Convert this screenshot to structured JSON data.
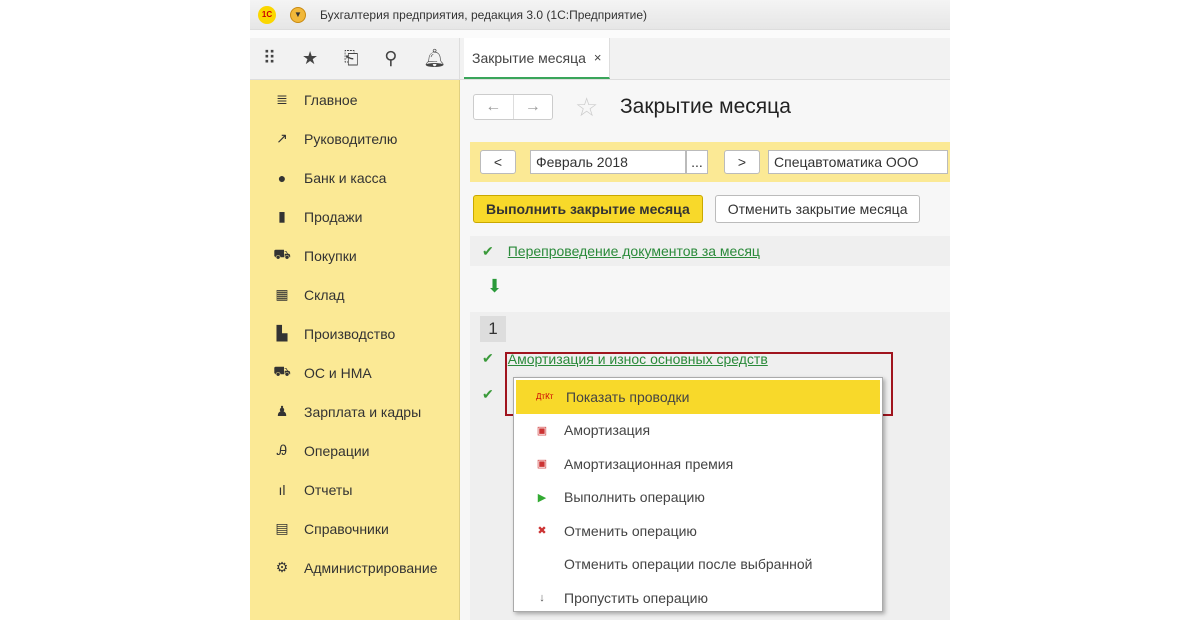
{
  "window": {
    "title": "Бухгалтерия предприятия, редакция 3.0  (1С:Предприятие)",
    "logo": "1С"
  },
  "toolbar": {
    "icons": [
      "apps-grid-icon",
      "star-icon",
      "history-icon",
      "search-icon",
      "bell-icon"
    ]
  },
  "tab": {
    "label": "Закрытие месяца",
    "close": "×"
  },
  "sidebar": {
    "items": [
      {
        "label": "Главное",
        "icon": "≣"
      },
      {
        "label": "Руководителю",
        "icon": "↗"
      },
      {
        "label": "Банк и касса",
        "icon": "●"
      },
      {
        "label": "Продажи",
        "icon": "▮"
      },
      {
        "label": "Покупки",
        "icon": "⛟"
      },
      {
        "label": "Склад",
        "icon": "▦"
      },
      {
        "label": "Производство",
        "icon": "▙"
      },
      {
        "label": "ОС и НМА",
        "icon": "⛟"
      },
      {
        "label": "Зарплата и кадры",
        "icon": "♟"
      },
      {
        "label": "Операции",
        "icon": "Ꭿ"
      },
      {
        "label": "Отчеты",
        "icon": "ıl"
      },
      {
        "label": "Справочники",
        "icon": "▤"
      },
      {
        "label": "Администрирование",
        "icon": "⚙"
      }
    ]
  },
  "page": {
    "title": "Закрытие месяца",
    "back": "←",
    "forward": "→",
    "star": "☆"
  },
  "filters": {
    "prev": "<",
    "period": "Февраль 2018",
    "pick": "...",
    "next": ">",
    "org": "Спецавтоматика ООО"
  },
  "actions": {
    "run": "Выполнить закрытие месяца",
    "cancel": "Отменить закрытие месяца"
  },
  "steps": {
    "reposting": "Перепроведение документов за месяц",
    "check": "✔",
    "down": "⬇",
    "stage_number": "1",
    "depreciation": "Амортизация и износ основных средств"
  },
  "context_menu": {
    "items": [
      {
        "label": "Показать проводки",
        "icon": "ДтКт"
      },
      {
        "label": "Амортизация",
        "icon": "▣"
      },
      {
        "label": "Амортизационная премия",
        "icon": "▣"
      },
      {
        "label": "Выполнить операцию",
        "icon": "▶"
      },
      {
        "label": "Отменить операцию",
        "icon": "✖"
      },
      {
        "label": "Отменить операции после выбранной",
        "icon": ""
      },
      {
        "label": "Пропустить операцию",
        "icon": "↓"
      }
    ]
  }
}
